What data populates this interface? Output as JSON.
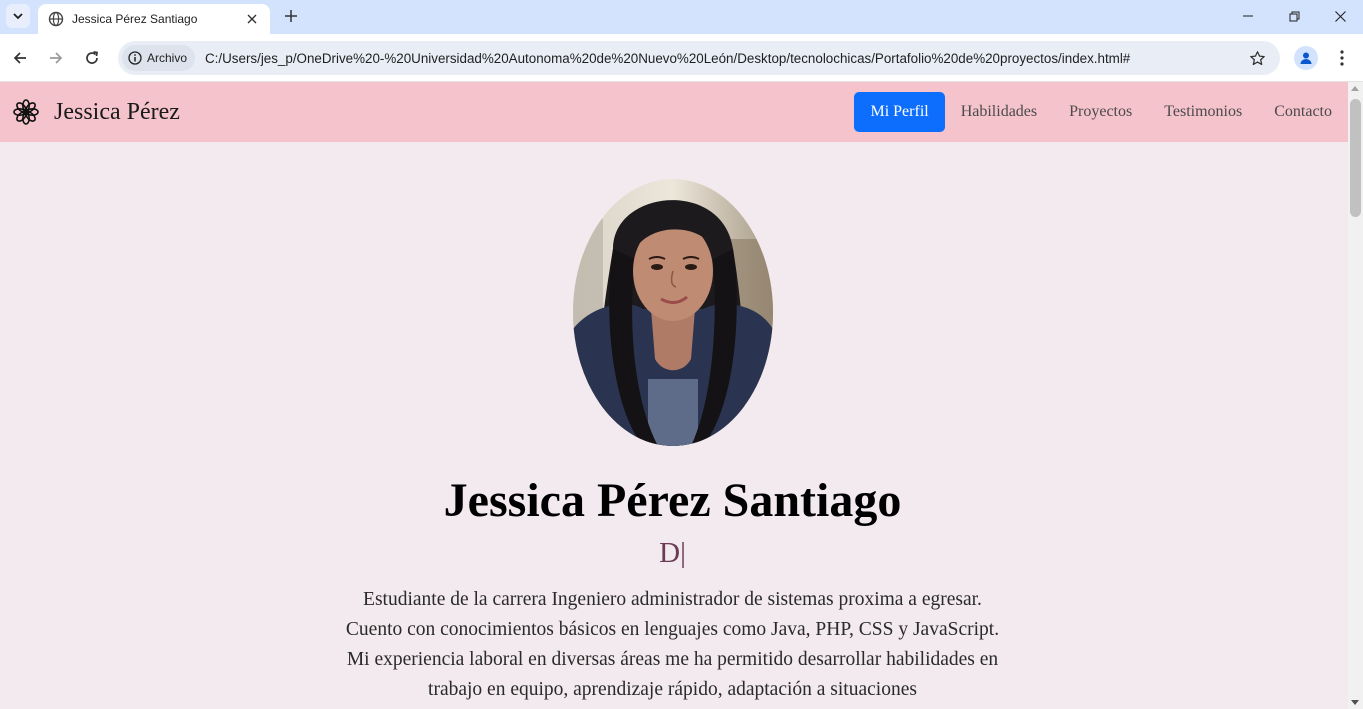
{
  "browser": {
    "tab": {
      "title": "Jessica Pérez Santiago",
      "favicon": "globe-icon"
    },
    "address": {
      "chip_label": "Archivo",
      "url": "C:/Users/jes_p/OneDrive%20-%20Universidad%20Autonoma%20de%20Nuevo%20León/Desktop/tecnolochicas/Portafolio%20de%20proyectos/index.html#"
    },
    "icons": [
      "tab-search-icon",
      "close-icon",
      "plus-icon",
      "minimize-icon",
      "restore-icon",
      "window-close-icon",
      "back-arrow-icon",
      "forward-arrow-icon",
      "reload-icon",
      "info-icon",
      "star-icon",
      "profile-icon",
      "kebab-menu-icon"
    ]
  },
  "site": {
    "brand": {
      "name": "Jessica Pérez",
      "icon": "flower-icon"
    },
    "nav": [
      {
        "label": "Mi Perfil",
        "active": true
      },
      {
        "label": "Habilidades",
        "active": false
      },
      {
        "label": "Proyectos",
        "active": false
      },
      {
        "label": "Testimonios",
        "active": false
      },
      {
        "label": "Contacto",
        "active": false
      }
    ],
    "colors": {
      "navbar": "#f5c3cc",
      "page_bg": "#f2eaee",
      "active_link": "#0d6efd",
      "typed_text": "#6b3a55"
    }
  },
  "profile": {
    "name": "Jessica Pérez Santiago",
    "typed_text": "D|",
    "bio": "Estudiante de la carrera Ingeniero administrador de sistemas proxima a egresar. Cuento con conocimientos básicos en lenguajes como Java, PHP, CSS y JavaScript. Mi experiencia laboral en diversas áreas me ha permitido desarrollar habilidades en trabajo en equipo, aprendizaje rápido, adaptación a situaciones"
  }
}
